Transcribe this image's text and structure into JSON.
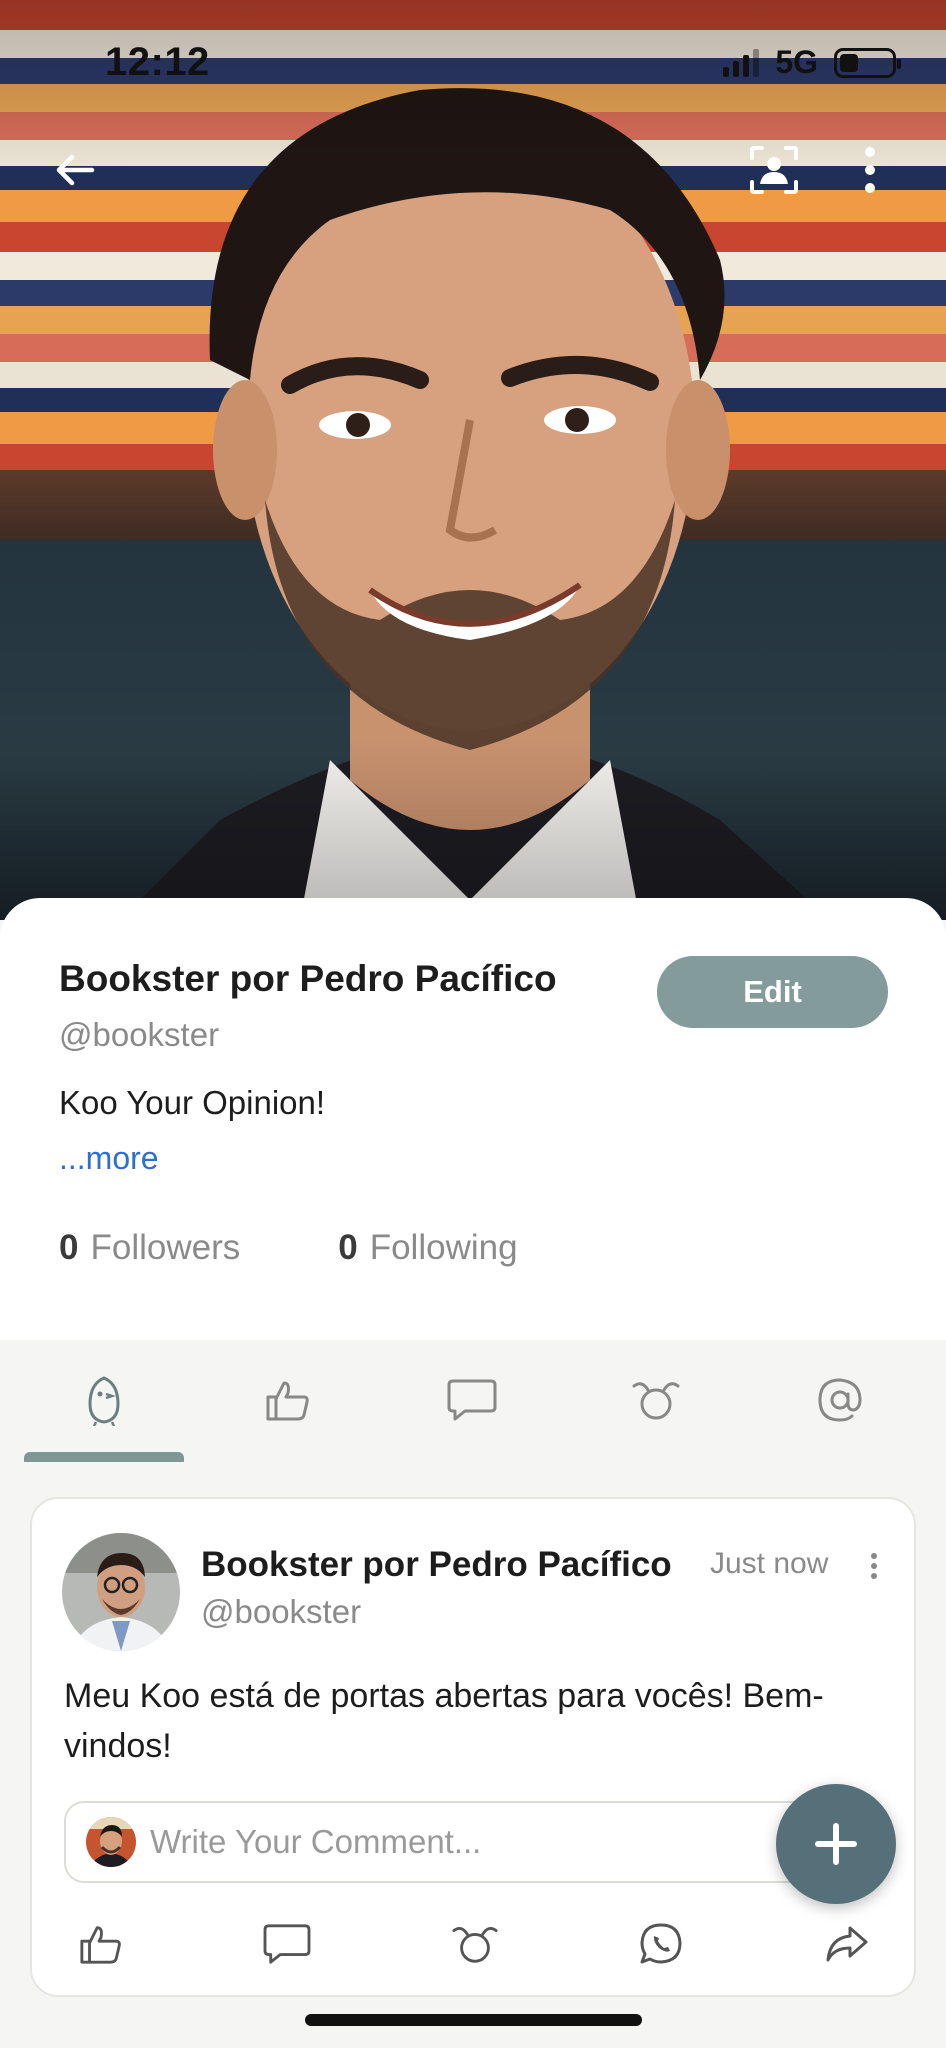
{
  "status_bar": {
    "time": "12:12",
    "network": "5G",
    "battery_level": 0.35
  },
  "header": {
    "back_icon": "arrow-left-icon",
    "scan_icon": "profile-scan-icon",
    "menu_icon": "vertical-dots-icon"
  },
  "profile": {
    "name": "Bookster por Pedro Pacífico",
    "handle": "@bookster",
    "bio": "Koo Your Opinion!",
    "more_label": "...more",
    "edit_label": "Edit",
    "followers_count": "0",
    "followers_label": "Followers",
    "following_count": "0",
    "following_label": "Following"
  },
  "tabs": [
    {
      "icon": "koo-bird-icon",
      "active": true
    },
    {
      "icon": "thumbs-up-icon",
      "active": false
    },
    {
      "icon": "comment-icon",
      "active": false
    },
    {
      "icon": "rekoo-icon",
      "active": false
    },
    {
      "icon": "mention-icon",
      "active": false
    }
  ],
  "post": {
    "author": "Bookster por Pedro Pacífico",
    "handle": "@bookster",
    "time": "Just now",
    "text": "Meu Koo está de portas abertas para vocês! Bem-vindos!",
    "comment_placeholder": "Write Your Comment...",
    "actions": [
      "like-icon",
      "comment-icon",
      "rekoo-icon",
      "whatsapp-icon",
      "share-icon"
    ]
  },
  "colors": {
    "accent": "#849b9b",
    "link": "#2c6fd1",
    "fab": "#56707a"
  }
}
